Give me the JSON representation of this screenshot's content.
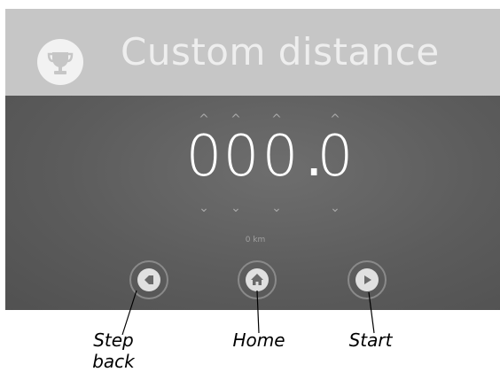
{
  "header": {
    "title": "Custom distance",
    "icon": "trophy-icon"
  },
  "display": {
    "digits": [
      "0",
      "0",
      "0",
      "0"
    ],
    "decimal_point": ".",
    "unit": "0 km",
    "up_arrow": "^",
    "down_arrow": "⌄"
  },
  "nav": {
    "back_icon": "step-back-icon",
    "home_icon": "home-icon",
    "start_icon": "play-icon"
  },
  "callouts": {
    "step_back": "Step\nback",
    "home": "Home",
    "start": "Start"
  }
}
